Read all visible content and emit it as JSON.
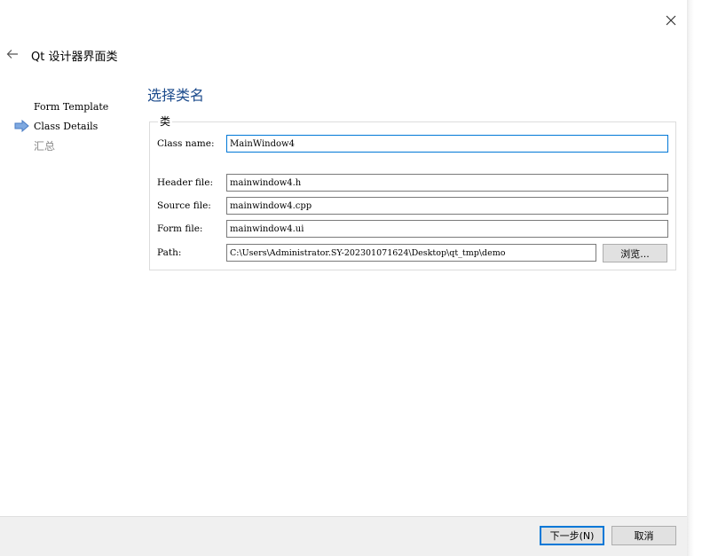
{
  "wizard": {
    "title": "Qt 设计器界面类",
    "page_title": "选择类名"
  },
  "steps": [
    {
      "label": "Form Template",
      "state": "done"
    },
    {
      "label": "Class Details",
      "state": "current"
    },
    {
      "label": "汇总",
      "state": "pending"
    }
  ],
  "group": {
    "title": "类"
  },
  "fields": {
    "class_name": {
      "label": "Class name:",
      "value": "MainWindow4"
    },
    "header_file": {
      "label": "Header file:",
      "value": "mainwindow4.h"
    },
    "source_file": {
      "label": "Source file:",
      "value": "mainwindow4.cpp"
    },
    "form_file": {
      "label": "Form file:",
      "value": "mainwindow4.ui"
    },
    "path": {
      "label": "Path:",
      "value": "C:\\Users\\Administrator.SY-20230107162​4\\Desktop\\qt_tmp\\demo"
    }
  },
  "buttons": {
    "browse": "浏览...",
    "next": "下一步(N)",
    "cancel": "取消"
  },
  "icons": {
    "close": "close-icon",
    "back": "arrow-left-icon",
    "current_step": "arrow-right-icon"
  },
  "colors": {
    "accent": "#0078d7",
    "title": "#1c4b8c",
    "step_arrow": "#5b8fd6"
  }
}
